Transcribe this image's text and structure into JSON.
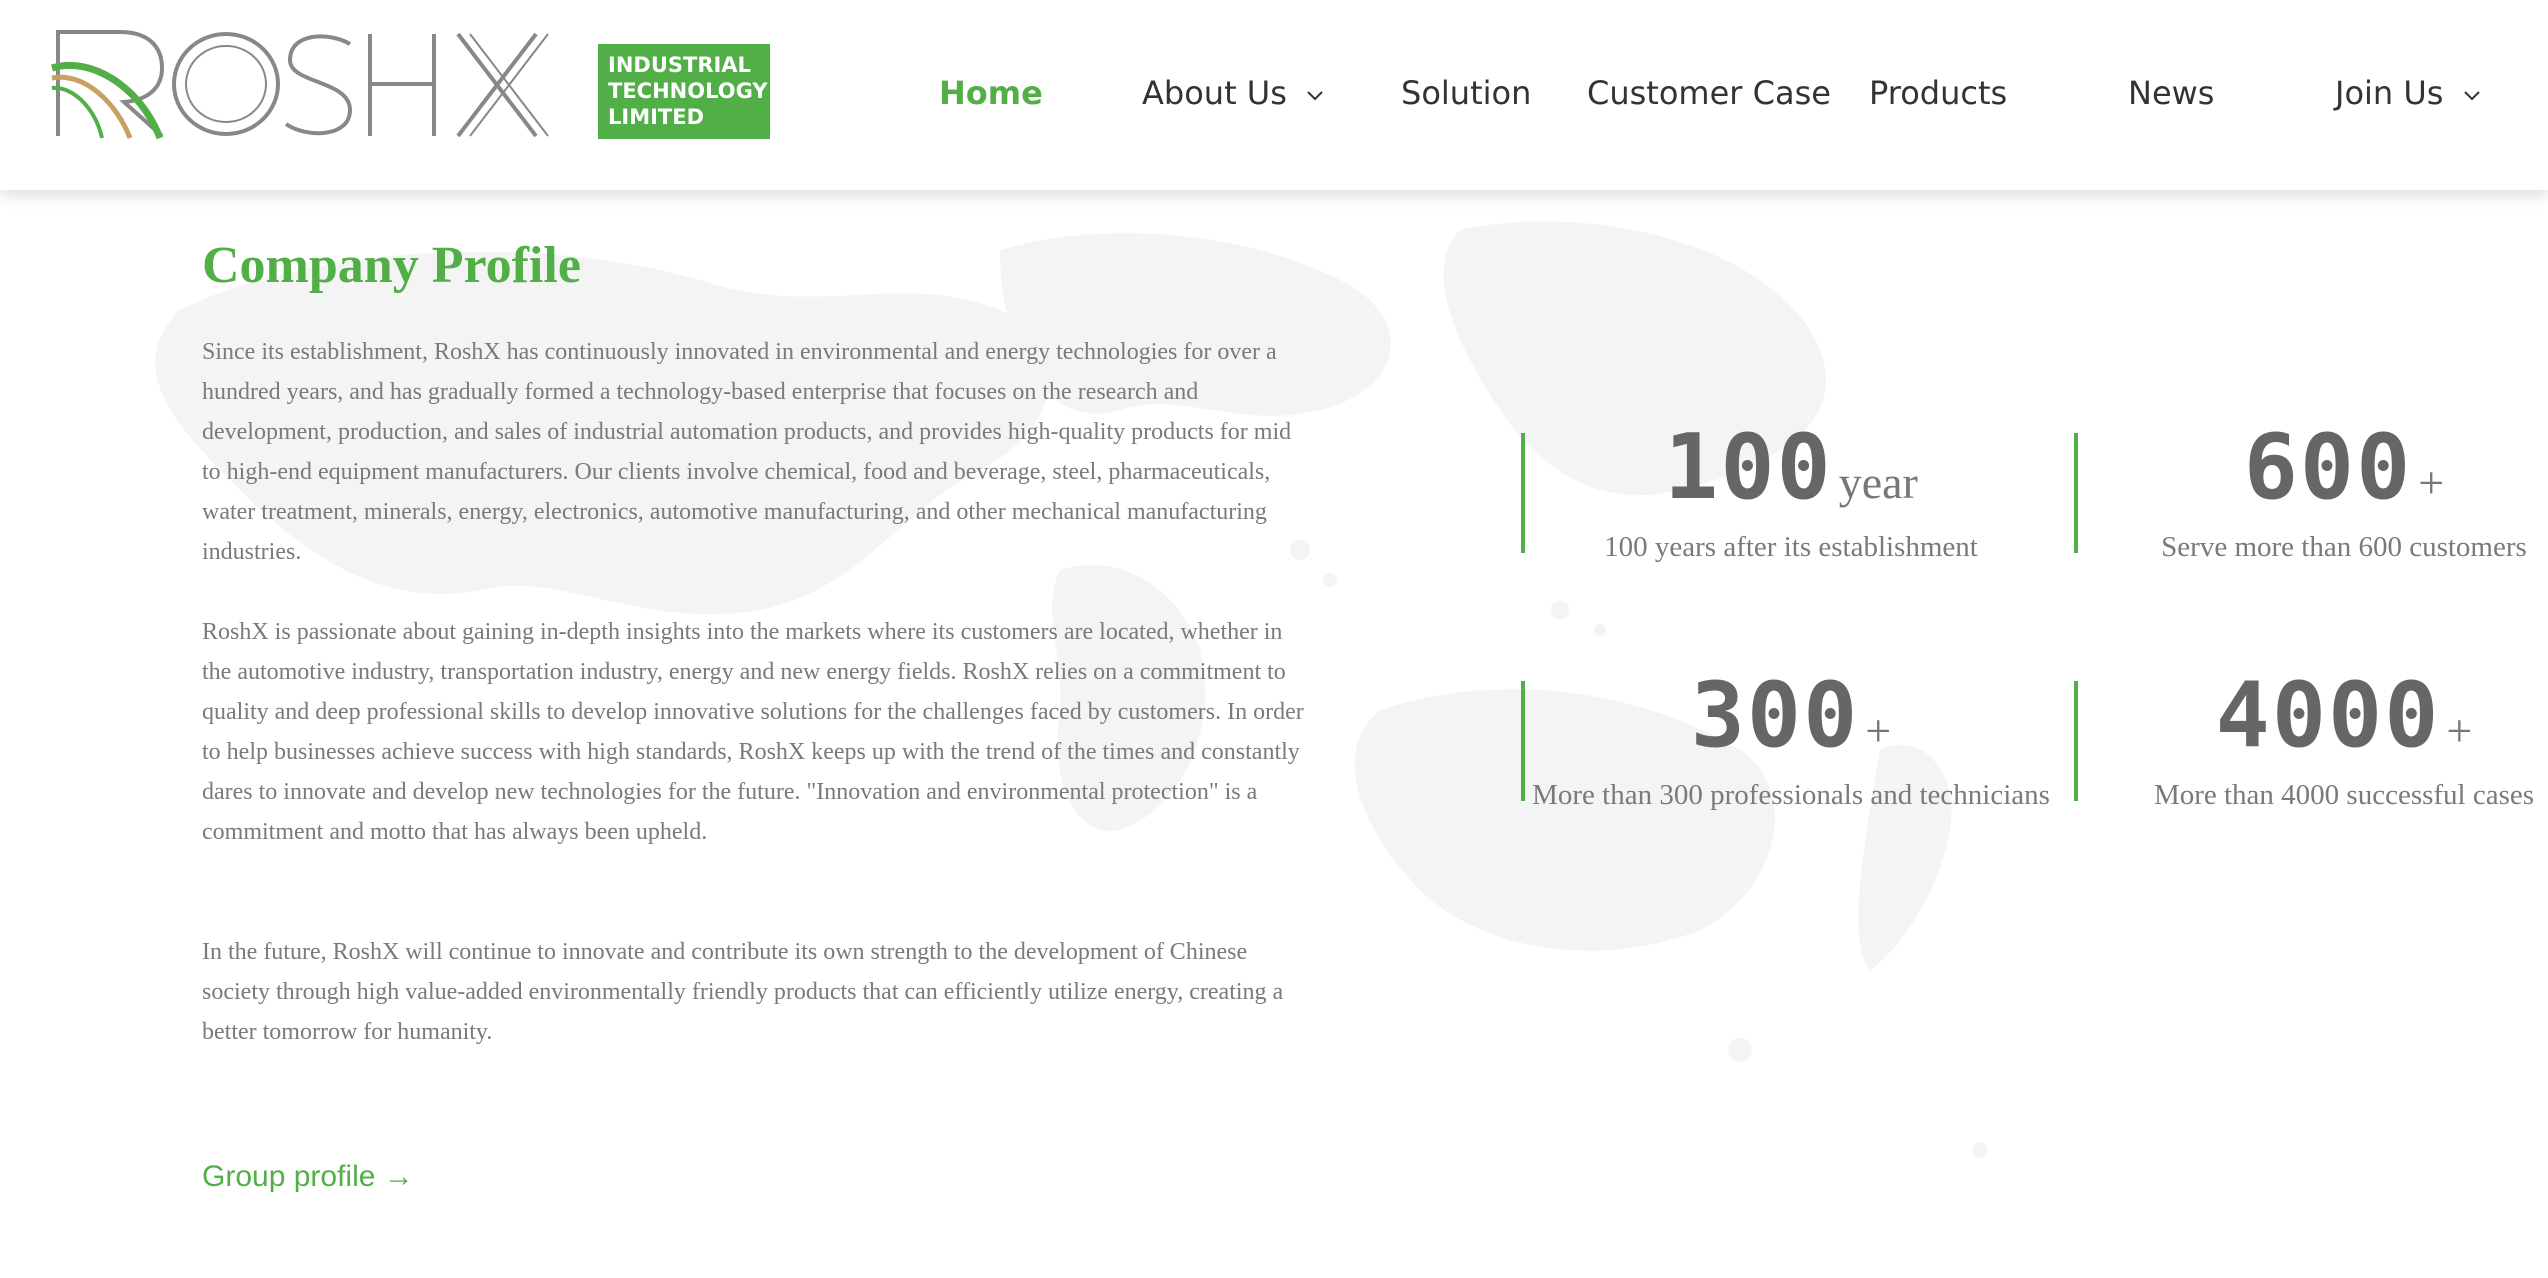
{
  "logo": {
    "wordmark": "ROSHX",
    "badge_lines": [
      "INDUSTRIAL",
      "TECHNOLOGY",
      "LIMITED"
    ]
  },
  "nav": {
    "items": [
      {
        "label": "Home",
        "active": true,
        "dropdown": false
      },
      {
        "label": "About Us",
        "active": false,
        "dropdown": true
      },
      {
        "label": "Solution",
        "active": false,
        "dropdown": false
      },
      {
        "label": "Customer Case",
        "active": false,
        "dropdown": false
      },
      {
        "label": "Products",
        "active": false,
        "dropdown": false
      },
      {
        "label": "News",
        "active": false,
        "dropdown": false
      },
      {
        "label": "Join Us",
        "active": false,
        "dropdown": true
      }
    ]
  },
  "profile": {
    "title": "Company Profile",
    "paragraphs": [
      "Since its establishment, RoshX has continuously innovated in environmental and energy technologies for over a hundred years, and has gradually formed a technology-based enterprise that focuses on the research and development, production, and sales of industrial automation products, and provides high-quality products for mid to high-end equipment manufacturers. Our clients involve chemical, food and beverage, steel, pharmaceuticals, water treatment, minerals, energy, electronics, automotive manufacturing, and other mechanical manufacturing industries.",
      "RoshX is passionate about gaining in-depth insights into the markets where its customers are located, whether in the automotive industry, transportation industry, energy and new energy fields. RoshX relies on a commitment to quality and deep professional skills to develop innovative solutions for the challenges faced by customers. In order to help businesses achieve success with high standards, RoshX keeps up with the trend of the times and constantly dares to innovate and develop new technologies for the future. \"Innovation and environmental protection\" is a commitment and motto that has always been upheld.",
      "In the future, RoshX will continue to innovate and contribute its own strength to the development of Chinese society through high value-added environmentally friendly products that can efficiently utilize energy, creating a better tomorrow for humanity."
    ],
    "group_link": "Group profile →"
  },
  "stats": [
    {
      "number": "100",
      "unit": "year",
      "desc": "100 years after its establishment"
    },
    {
      "number": "600",
      "unit": "+",
      "desc": "Serve more than 600 customers"
    },
    {
      "number": "300",
      "unit": "+",
      "desc": "More than 300 professionals and technicians"
    },
    {
      "number": "4000",
      "unit": "+",
      "desc": "More than 4000 successful cases"
    }
  ],
  "colors": {
    "brand_green": "#52ae47",
    "text_gray": "#7a7a7a",
    "number_gray": "#666666"
  }
}
